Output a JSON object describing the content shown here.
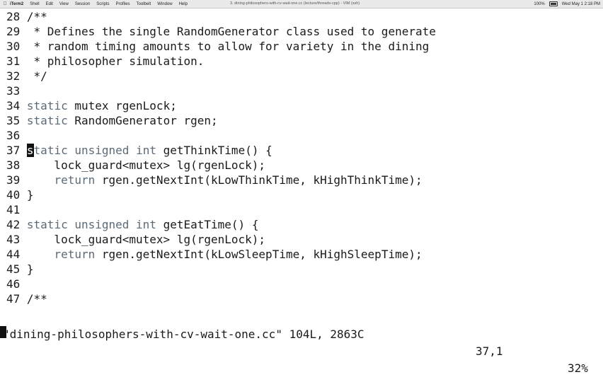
{
  "menubar": {
    "apple_icon": "apple-icon",
    "items": [
      "iTerm2",
      "Shell",
      "Edit",
      "View",
      "Session",
      "Scripts",
      "Profiles",
      "Toolbelt",
      "Window",
      "Help"
    ],
    "window_title": "3. dining-philosophers-with-cv-wait-one.cc (lecture/threads-cpp) - VIM (ssh)",
    "battery": "100%",
    "clock": "Wed May 1 2:18 PM"
  },
  "editor": {
    "lines": [
      {
        "n": "28",
        "text": " /**"
      },
      {
        "n": "29",
        "text": "  * Defines the single RandomGenerator class used to generate"
      },
      {
        "n": "30",
        "text": "  * random timing amounts to allow for variety in the dining"
      },
      {
        "n": "31",
        "text": "  * philosopher simulation."
      },
      {
        "n": "32",
        "text": "  */"
      },
      {
        "n": "33",
        "text": ""
      },
      {
        "n": "34",
        "kw": "static",
        "rest": " mutex rgenLock;"
      },
      {
        "n": "35",
        "kw": "static",
        "rest": " RandomGenerator rgen;"
      },
      {
        "n": "36",
        "text": ""
      },
      {
        "n": "37",
        "cursor": "s",
        "kw_tail": "tatic",
        "kw2": "unsigned",
        "kw3": "int",
        "rest": " getThinkTime() {"
      },
      {
        "n": "38",
        "text": "     lock_guard<mutex> lg(rgenLock);"
      },
      {
        "n": "39",
        "kw_lead": "     ",
        "kw": "return",
        "rest": " rgen.getNextInt(kLowThinkTime, kHighThinkTime);"
      },
      {
        "n": "40",
        "text": " }"
      },
      {
        "n": "41",
        "text": ""
      },
      {
        "n": "42",
        "kw": "static",
        "kw2": "unsigned",
        "kw3": "int",
        "rest": " getEatTime() {"
      },
      {
        "n": "43",
        "text": "     lock_guard<mutex> lg(rgenLock);"
      },
      {
        "n": "44",
        "kw_lead": "     ",
        "kw": "return",
        "rest": " rgen.getNextInt(kLowSleepTime, kHighSleepTime);"
      },
      {
        "n": "45",
        "text": " }"
      },
      {
        "n": "46",
        "text": ""
      },
      {
        "n": "47",
        "text": " /**"
      }
    ]
  },
  "statusline": {
    "file": "\"dining-philosophers-with-cv-wait-one.cc\" 104L, 2863C",
    "position": "37,1",
    "percent": "32%"
  }
}
